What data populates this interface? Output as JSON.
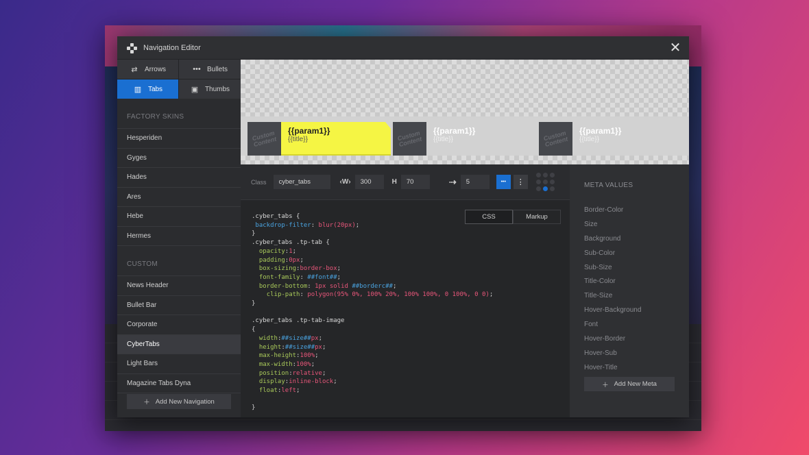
{
  "window": {
    "title": "Navigation Editor"
  },
  "types": [
    {
      "label": "Arrows",
      "icon": "⇄",
      "icon_name": "arrows-icon",
      "active": false
    },
    {
      "label": "Bullets",
      "icon": "•••",
      "icon_name": "bullets-icon",
      "active": false
    },
    {
      "label": "Tabs",
      "icon": "▥",
      "icon_name": "tabs-icon",
      "active": true
    },
    {
      "label": "Thumbs",
      "icon": "▣",
      "icon_name": "thumbs-icon",
      "active": false
    }
  ],
  "factory": {
    "heading": "FACTORY SKINS",
    "items": [
      "Hesperiden",
      "Gyges",
      "Hades",
      "Ares",
      "Hebe",
      "Hermes"
    ]
  },
  "custom": {
    "heading": "CUSTOM",
    "items": [
      "News Header",
      "Bullet Bar",
      "Corporate",
      "CyberTabs",
      "Light Bars",
      "Magazine Tabs Dyna"
    ],
    "active": "CyberTabs"
  },
  "add_navigation": "Add New Navigation",
  "preview": {
    "thumb_text": "Custom Content",
    "tabs": [
      {
        "param": "{{param1}}",
        "title": "{{title}}"
      },
      {
        "param": "{{param1}}",
        "title": "{{title}}"
      },
      {
        "param": "{{param1}}",
        "title": "{{title}}"
      }
    ]
  },
  "toolbar": {
    "class_label": "Class",
    "class_value": "cyber_tabs",
    "w_label": "‹W›",
    "w_value": "300",
    "h_label": "H",
    "h_value": "70",
    "spacing_icon": "⇢",
    "spacing_value": "5",
    "more_icon": "•••",
    "menu_icon": "⋮"
  },
  "editor": {
    "tabs": [
      "CSS",
      "Markup"
    ],
    "active_tab": "CSS"
  },
  "meta": {
    "heading": "META VALUES",
    "items": [
      "Border-Color",
      "Size",
      "Background",
      "Sub-Color",
      "Sub-Size",
      "Title-Color",
      "Title-Size",
      "Hover-Background",
      "Font",
      "Hover-Border",
      "Hover-Sub",
      "Hover-Title"
    ],
    "add_label": "Add New Meta"
  },
  "colors": {
    "accent": "#1a6fd1",
    "tab_active": "#f5f544"
  }
}
